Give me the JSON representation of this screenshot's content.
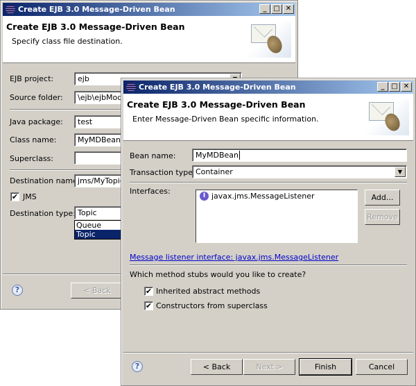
{
  "back_dialog": {
    "window_title": "Create EJB 3.0 Message-Driven Bean",
    "header_title": "Create EJB 3.0 Message-Driven Bean",
    "header_subtitle": "Specify class file destination.",
    "fields": {
      "ejb_project": {
        "label": "EJB project:",
        "value": "ejb"
      },
      "source_folder": {
        "label": "Source folder:",
        "value": "\\ejb\\ejbModu"
      },
      "java_package": {
        "label": "Java package:",
        "value": "test"
      },
      "class_name": {
        "label": "Class name:",
        "value": "MyMDBean"
      },
      "superclass": {
        "label": "Superclass:",
        "value": ""
      },
      "destination_name": {
        "label": "Destination name:",
        "value": "jms/MyTopic"
      },
      "jms": {
        "label": "JMS",
        "checked": true
      },
      "destination_type": {
        "label": "Destination type:",
        "value": "Topic",
        "options": [
          "Queue",
          "Topic"
        ]
      }
    },
    "buttons": {
      "back": "< Back"
    }
  },
  "front_dialog": {
    "window_title": "Create EJB 3.0 Message-Driven Bean",
    "header_title": "Create EJB 3.0 Message-Driven Bean",
    "header_subtitle": "Enter Message-Driven Bean specific information.",
    "bean_name": {
      "label": "Bean name:",
      "value": "MyMDBean"
    },
    "transaction_type": {
      "label": "Transaction type:",
      "value": "Container"
    },
    "interfaces": {
      "label": "Interfaces:",
      "items": [
        "javax.jms.MessageListener"
      ],
      "add": "Add...",
      "remove": "Remove"
    },
    "link": "Message listener interface: javax.jms.MessageListener",
    "stubs_question": "Which method stubs would you like to create?",
    "stubs": [
      {
        "label": "Inherited abstract methods",
        "checked": true
      },
      {
        "label": "Constructors from superclass",
        "checked": true
      }
    ],
    "buttons": {
      "back": "< Back",
      "next": "Next >",
      "finish": "Finish",
      "cancel": "Cancel"
    }
  },
  "colors": {
    "title_start": "#0a246a",
    "title_end": "#a6caf0",
    "dialog_bg": "#d4d0c8",
    "link": "#0000cc",
    "selection": "#0a246a"
  },
  "window_buttons": {
    "minimize": "_",
    "maximize": "□",
    "close": "✕"
  },
  "help_glyph": "?",
  "check_glyph": "✔",
  "interface_glyph": "I",
  "dropdown_glyph": "▼"
}
